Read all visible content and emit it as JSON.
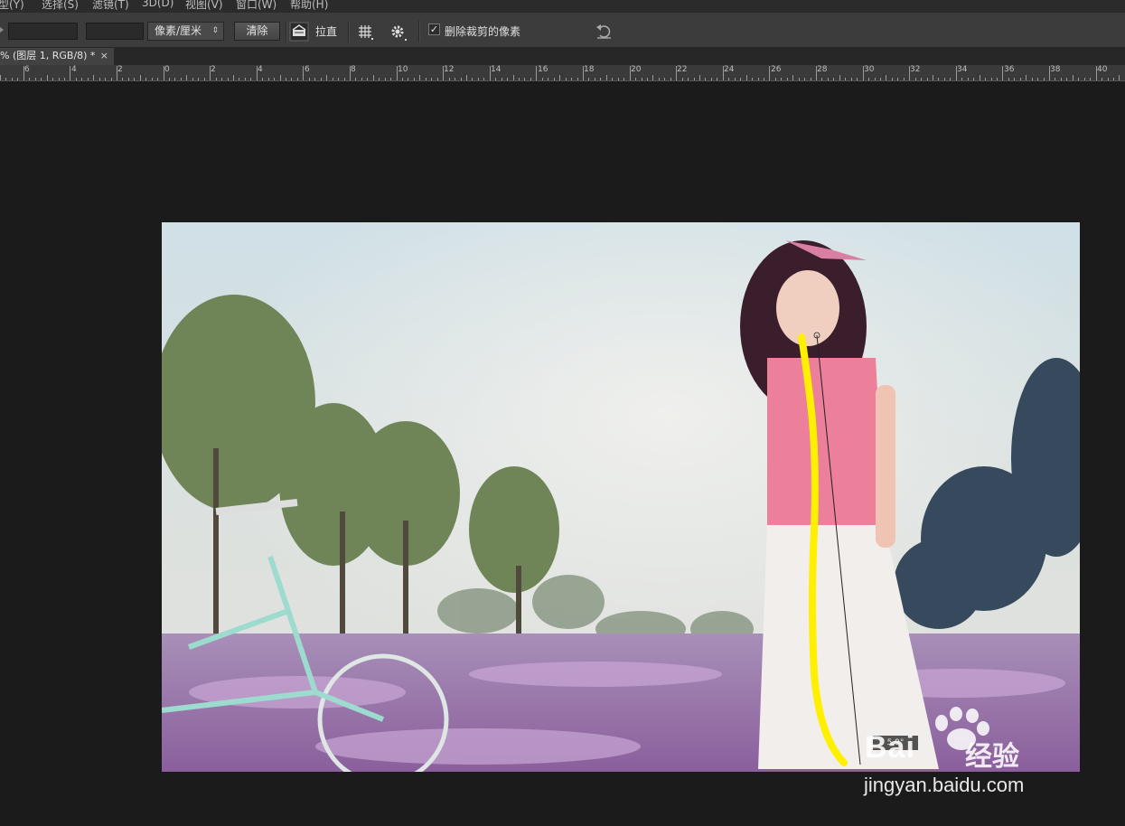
{
  "menu": [
    "型(Y)",
    "选择(S)",
    "滤镜(T)",
    "3D(D)",
    "视图(V)",
    "窗口(W)",
    "帮助(H)"
  ],
  "options": {
    "unit_select": "像素/厘米",
    "clear_button": "清除",
    "straighten_label": "拉直",
    "delete_cropped_label": "删除裁剪的像素",
    "delete_cropped_checked": true
  },
  "tab": {
    "title": "% (图层 1, RGB/8) *",
    "close": "×"
  },
  "ruler": {
    "labels": [
      "6",
      "4",
      "2",
      "0",
      "2",
      "4",
      "6",
      "8",
      "10",
      "12",
      "14",
      "16",
      "18",
      "20",
      "22",
      "24",
      "26",
      "28",
      "30",
      "32",
      "34",
      "36",
      "38",
      "40"
    ]
  },
  "overlay": {
    "angle_readout": "5.9°"
  },
  "watermark": {
    "logo": "Bai",
    "logo_suffix": "经验",
    "site": "jingyan.baidu.com"
  },
  "colors": {
    "accent_line": "#ffef00",
    "ui_bg": "#3c3c3c",
    "canvas_bg": "#1b1b1b"
  }
}
